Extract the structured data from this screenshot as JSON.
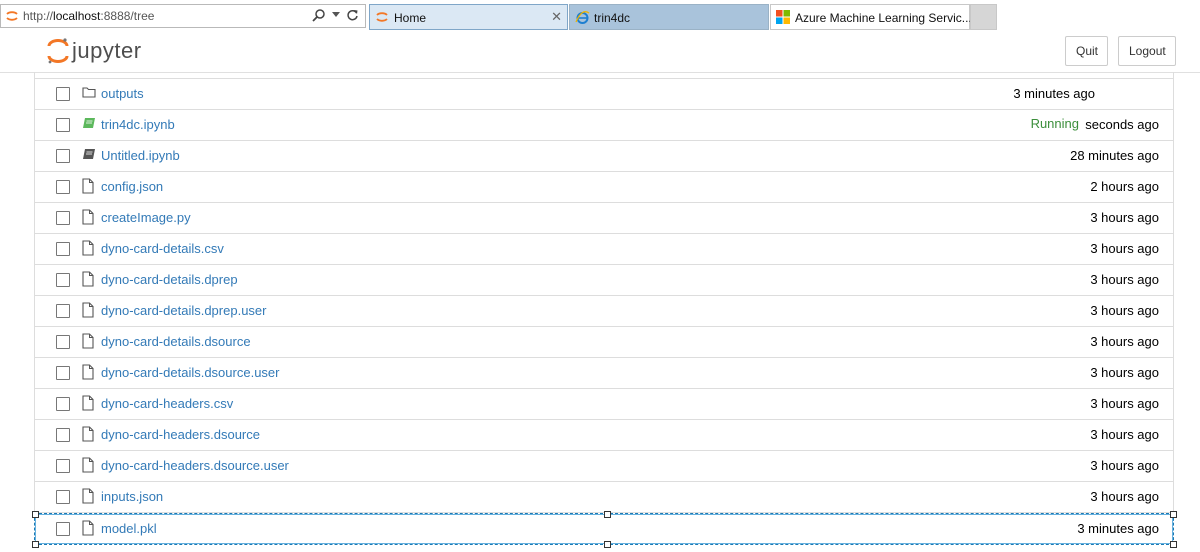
{
  "browser": {
    "url_prefix": "http://",
    "url_host": "localhost",
    "url_rest": ":8888/tree",
    "tabs": [
      {
        "label": "Home"
      },
      {
        "label": "trin4dc"
      },
      {
        "label": "Azure Machine Learning Servic..."
      }
    ]
  },
  "header": {
    "logo_text": "jupyter",
    "quit_label": "Quit",
    "logout_label": "Logout"
  },
  "files": [
    {
      "name": "outputs",
      "time": "3 minutes ago",
      "type": "folder"
    },
    {
      "name": "trin4dc.ipynb",
      "time": "seconds ago",
      "status": "Running",
      "type": "notebook-running"
    },
    {
      "name": "Untitled.ipynb",
      "time": "28 minutes ago",
      "type": "notebook"
    },
    {
      "name": "config.json",
      "time": "2 hours ago",
      "type": "file"
    },
    {
      "name": "createImage.py",
      "time": "3 hours ago",
      "type": "file"
    },
    {
      "name": "dyno-card-details.csv",
      "time": "3 hours ago",
      "type": "file"
    },
    {
      "name": "dyno-card-details.dprep",
      "time": "3 hours ago",
      "type": "file"
    },
    {
      "name": "dyno-card-details.dprep.user",
      "time": "3 hours ago",
      "type": "file"
    },
    {
      "name": "dyno-card-details.dsource",
      "time": "3 hours ago",
      "type": "file"
    },
    {
      "name": "dyno-card-details.dsource.user",
      "time": "3 hours ago",
      "type": "file"
    },
    {
      "name": "dyno-card-headers.csv",
      "time": "3 hours ago",
      "type": "file"
    },
    {
      "name": "dyno-card-headers.dsource",
      "time": "3 hours ago",
      "type": "file"
    },
    {
      "name": "dyno-card-headers.dsource.user",
      "time": "3 hours ago",
      "type": "file"
    },
    {
      "name": "inputs.json",
      "time": "3 hours ago",
      "type": "file"
    },
    {
      "name": "model.pkl",
      "time": "3 minutes ago",
      "type": "file"
    }
  ],
  "colors": {
    "link": "#337ab7",
    "running": "#3c8f3c",
    "jupyter_orange": "#f37726"
  }
}
